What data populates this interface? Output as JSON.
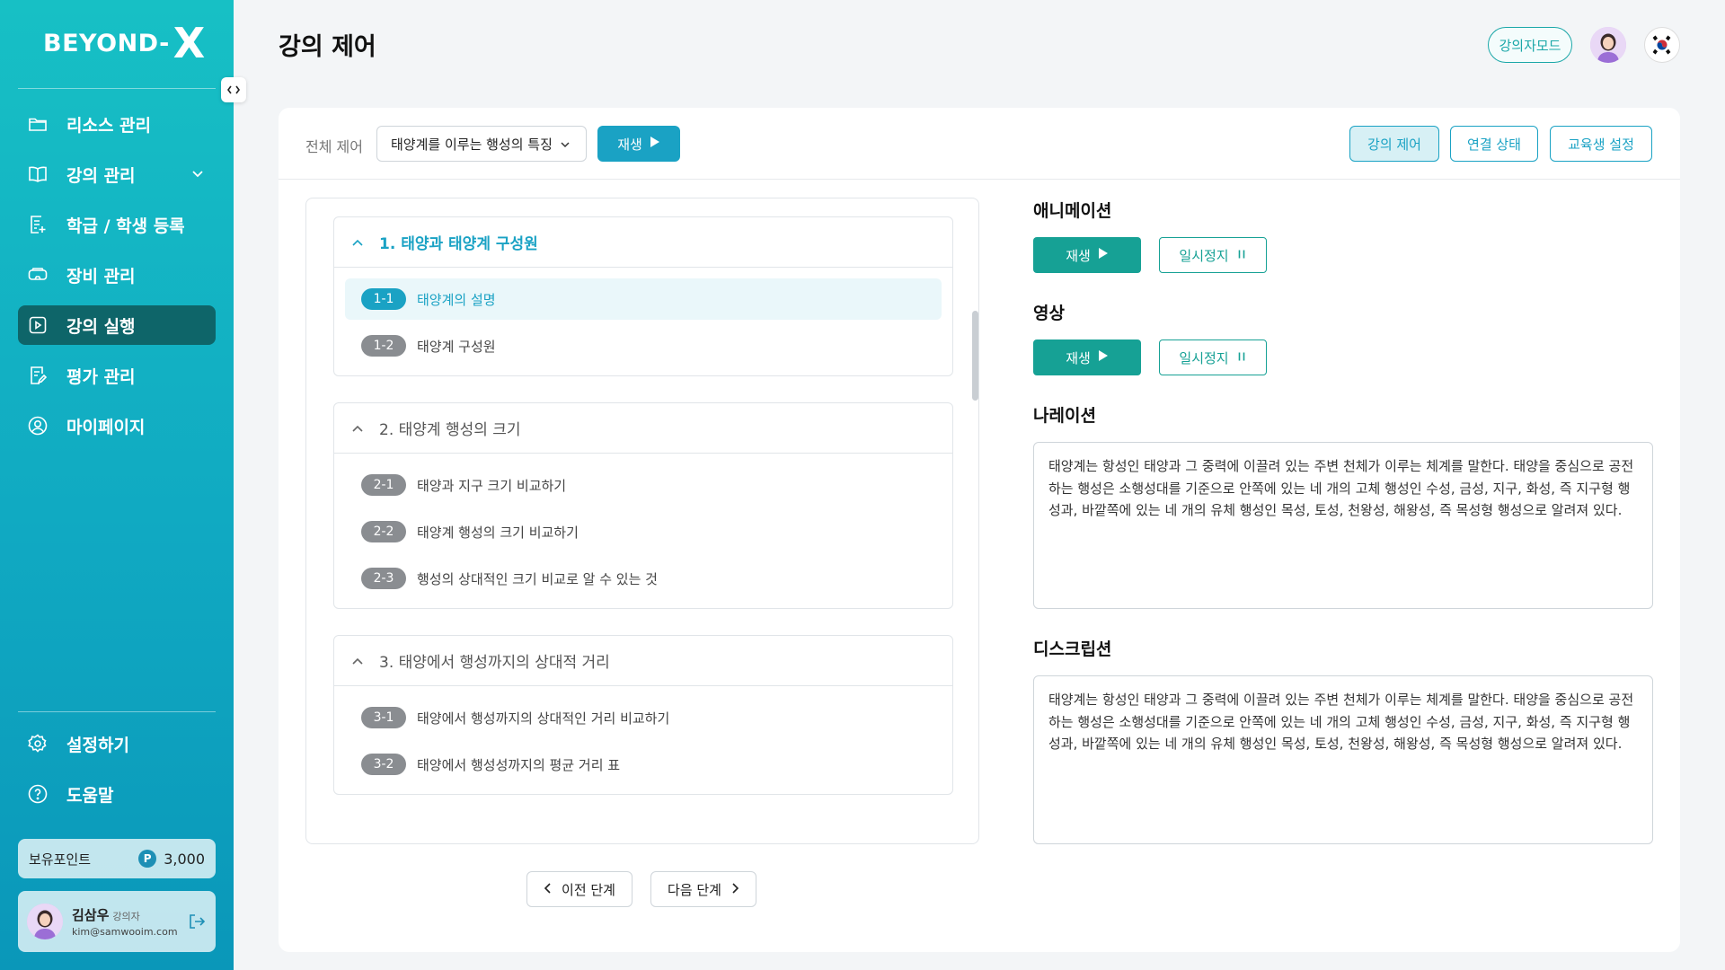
{
  "app": {
    "logo_text": "BEYOND-",
    "logo_mark": "X"
  },
  "sidebar": {
    "items": [
      {
        "label": "리소스 관리",
        "icon": "folder-icon"
      },
      {
        "label": "강의 관리",
        "icon": "book-icon"
      },
      {
        "label": "학급 / 학생 등록",
        "icon": "register-doc-icon"
      },
      {
        "label": "장비 관리",
        "icon": "vr-headset-icon"
      },
      {
        "label": "강의 실행",
        "icon": "play-square-icon",
        "active": true
      },
      {
        "label": "평가 관리",
        "icon": "edit-doc-icon"
      },
      {
        "label": "마이페이지",
        "icon": "user-circle-icon"
      }
    ],
    "bottom_items": [
      {
        "label": "설정하기",
        "icon": "gear-icon"
      },
      {
        "label": "도움말",
        "icon": "help-icon"
      }
    ],
    "points": {
      "label": "보유포인트",
      "badge": "P",
      "value": "3,000"
    },
    "user": {
      "name": "김삼우",
      "role": "강의자",
      "email": "kim@samwooim.com"
    }
  },
  "header": {
    "title": "강의 제어",
    "mode_button": "강의자모드"
  },
  "toolbar": {
    "control_label": "전체 제어",
    "lesson_select": "태양계를 이루는 행성의 특징",
    "play_label": "재생",
    "tabs": [
      "강의 제어",
      "연결 상태",
      "교육생 설정"
    ]
  },
  "curriculum": [
    {
      "title": "1. 태양과 태양계 구성원",
      "active": true,
      "lessons": [
        {
          "num": "1-1",
          "label": "태양계의 설명",
          "active": true
        },
        {
          "num": "1-2",
          "label": "태양계 구성원"
        }
      ]
    },
    {
      "title": "2. 태양계 행성의 크기",
      "lessons": [
        {
          "num": "2-1",
          "label": "태양과 지구 크기 비교하기"
        },
        {
          "num": "2-2",
          "label": "태양계 행성의 크기 비교하기"
        },
        {
          "num": "2-3",
          "label": "행성의 상대적인 크기 비교로 알 수 있는 것"
        }
      ]
    },
    {
      "title": "3. 태양에서 행성까지의 상대적 거리",
      "lessons": [
        {
          "num": "3-1",
          "label": "태양에서 행성까지의 상대적인 거리 비교하기"
        },
        {
          "num": "3-2",
          "label": "태양에서 행성성까지의 평균 거리 표"
        }
      ]
    }
  ],
  "steps": {
    "prev": "이전 단계",
    "next": "다음 단계"
  },
  "panel": {
    "animation": {
      "title": "애니메이션",
      "play": "재생",
      "pause": "일시정지"
    },
    "video": {
      "title": "영상",
      "play": "재생",
      "pause": "일시정지"
    },
    "narration": {
      "title": "나레이션",
      "text": "태양계는 항성인 태양과 그 중력에 이끌려 있는 주변 천체가 이루는 체계를 말한다. 태양을 중심으로 공전하는 행성은 소행성대를 기준으로 안쪽에 있는 네 개의 고체 행성인 수성, 금성, 지구, 화성, 즉 지구형 행성과, 바깥쪽에 있는 네 개의 유체 행성인 목성, 토성, 천왕성, 해왕성, 즉 목성형 행성으로 알려져 있다."
    },
    "description": {
      "title": "디스크립션",
      "text": "태양계는 항성인 태양과 그 중력에 이끌려 있는 주변 천체가 이루는 체계를 말한다. 태양을 중심으로 공전하는 행성은 소행성대를 기준으로 안쪽에 있는 네 개의 고체 행성인 수성, 금성, 지구, 화성, 즉 지구형 행성과, 바깥쪽에 있는 네 개의 유체 행성인 목성, 토성, 천왕성, 해왕성, 즉 목성형 행성으로 알려져 있다."
    }
  },
  "colors": {
    "accent": "#1aa2c4",
    "teal": "#16a195",
    "sidebar_active": "#0e6569"
  }
}
